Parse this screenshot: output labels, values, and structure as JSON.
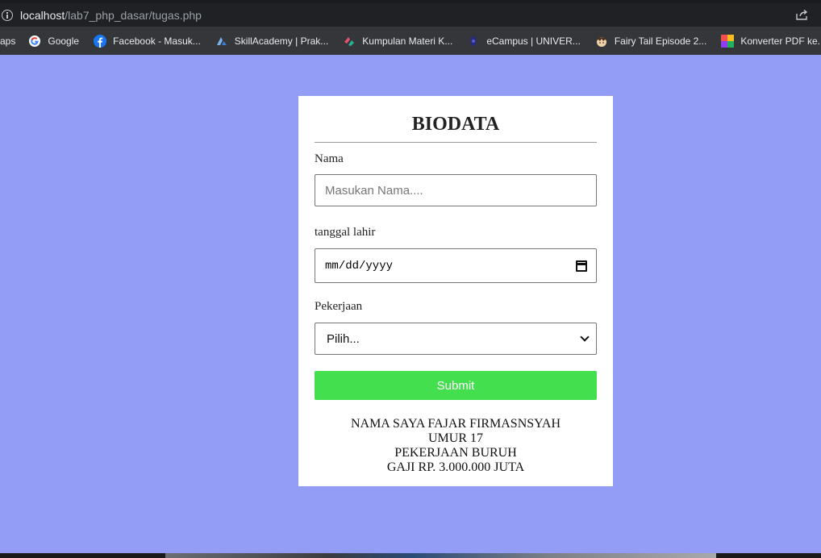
{
  "browser": {
    "url_host": "localhost",
    "url_path": "/lab7_php_dasar/tugas.php"
  },
  "bookmarks": {
    "apps_label": "aps",
    "items": [
      {
        "label": "Google",
        "icon": "google-icon"
      },
      {
        "label": "Facebook - Masuk...",
        "icon": "facebook-icon"
      },
      {
        "label": "SkillAcademy | Prak...",
        "icon": "skillacademy-icon"
      },
      {
        "label": "Kumpulan Materi K...",
        "icon": "materi-icon"
      },
      {
        "label": "eCampus | UNIVER...",
        "icon": "ecampus-icon"
      },
      {
        "label": "Fairy Tail Episode 2...",
        "icon": "fairytail-icon"
      },
      {
        "label": "Konverter PDF ke...",
        "icon": "pdf-icon"
      }
    ]
  },
  "form": {
    "title": "BIODATA",
    "nama_label": "Nama",
    "nama_placeholder": "Masukan Nama....",
    "nama_value": "",
    "tanggal_label": "tanggal lahir",
    "tanggal_placeholder": "mm/dd/yyyy",
    "pekerjaan_label": "Pekerjaan",
    "pekerjaan_selected": "Pilih...",
    "submit_label": "Submit"
  },
  "result": {
    "lines": [
      "NAMA SAYA FAJAR FIRMASNSYAH",
      "UMUR 17",
      "PEKERJAAN BURUH",
      "GAJI RP. 3.000.000 JUTA"
    ]
  },
  "colors": {
    "page_background": "#939df5",
    "card_background": "#ffffff",
    "submit_background": "#44df4e"
  }
}
